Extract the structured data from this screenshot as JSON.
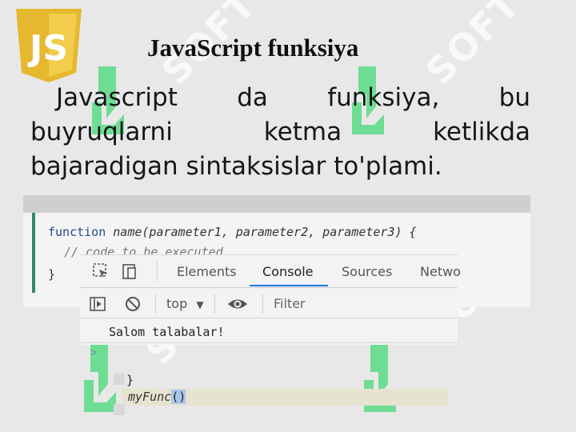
{
  "title": "JavaScript funksiya",
  "logo_text": "JS",
  "watermark_text": "SOFT",
  "paragraph": {
    "line1": [
      "Javascript",
      "da",
      "funksiya,",
      "bu"
    ],
    "line2": [
      "buyruqlarni",
      "ketma",
      "ketlikda"
    ],
    "line3": "bajaradigan sintaksislar to'plami."
  },
  "code": {
    "keyword": "function",
    "signature": "name(parameter1, parameter2, parameter3) {",
    "comment": "// code to be executed",
    "closing": "}"
  },
  "devtools": {
    "tabs": [
      "Elements",
      "Console",
      "Sources",
      "Netwo"
    ],
    "active_tab": "Console",
    "context": "top",
    "filter_placeholder": "Filter",
    "output": "Salom talabalar!",
    "prompt": ">",
    "brace": "}",
    "call_name": "myFunc",
    "call_parens": "()"
  },
  "colors": {
    "js_yellow": "#e6b830",
    "accent_green": "#2d8a6a",
    "watermark_green": "#5bdc86"
  }
}
